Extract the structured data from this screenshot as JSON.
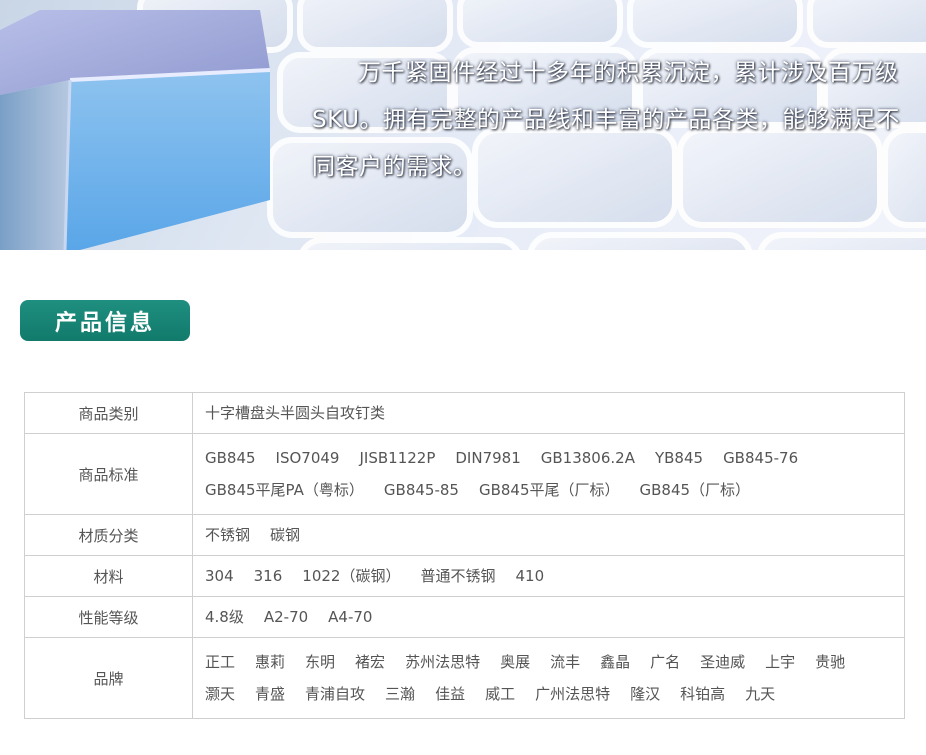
{
  "hero": {
    "text": "万千紧固件经过十多年的积累沉淀，累计涉及百万级SKU。拥有完整的产品线和丰富的产品各类，能够满足不同客户的需求。"
  },
  "section": {
    "title": "产品信息"
  },
  "table": {
    "rows": [
      {
        "label": "商品类别",
        "items": [
          "十字槽盘头半圆头自攻钉类"
        ]
      },
      {
        "label": "商品标准",
        "items": [
          "GB845",
          "ISO7049",
          "JISB1122P",
          "DIN7981",
          "GB13806.2A",
          "YB845",
          "GB845-76",
          "GB845平尾PA（粤标）",
          "GB845-85",
          "GB845平尾（厂标）",
          "GB845（厂标）"
        ]
      },
      {
        "label": "材质分类",
        "items": [
          "不锈钢",
          "碳钢"
        ]
      },
      {
        "label": "材料",
        "items": [
          "304",
          "316",
          "1022（碳钢）",
          "普通不锈钢",
          "410"
        ]
      },
      {
        "label": "性能等级",
        "items": [
          "4.8级",
          "A2-70",
          "A4-70"
        ]
      },
      {
        "label": "品牌",
        "items": [
          "正工",
          "惠莉",
          "东明",
          "褚宏",
          "苏州法思特",
          "奥展",
          "流丰",
          "鑫晶",
          "广名",
          "圣迪威",
          "上宇",
          "贵驰",
          "灏天",
          "青盛",
          "青浦自攻",
          "三瀚",
          "佳益",
          "威工",
          "广州法思特",
          "隆汉",
          "科铂高",
          "九天"
        ]
      }
    ]
  },
  "colors": {
    "badge": "#168577",
    "border": "#cfcfcf",
    "text": "#555555"
  }
}
